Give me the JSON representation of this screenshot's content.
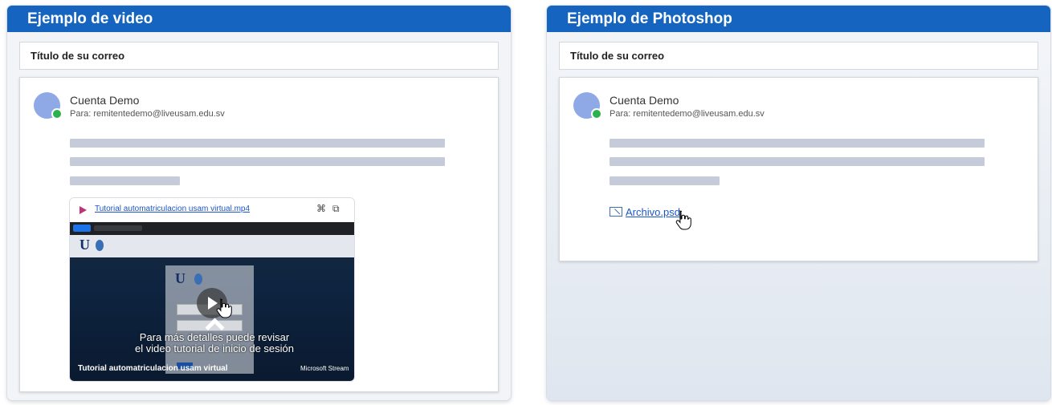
{
  "left": {
    "title": "Ejemplo de video",
    "subject": "Título de su correo",
    "sender_name": "Cuenta Demo",
    "sender_to": "Para:  remitentedemo@liveusam.edu.sv",
    "video": {
      "filename": "Tutorial automatriculacion usam virtual.mp4",
      "caption": "Para más detalles puede revisar el video tutorial de inicio de sesión",
      "title": "Tutorial automatriculacion usam virtual",
      "brand": "Microsoft Stream"
    }
  },
  "right": {
    "title": "Ejemplo de Photoshop",
    "subject": "Título de su correo",
    "sender_name": "Cuenta Demo",
    "sender_to": "Para:  remitentedemo@liveusam.edu.sv",
    "attachment": "Archivo.psd"
  },
  "colors": {
    "header": "#1565c0",
    "placeholder_bar": "#c6cbd9",
    "presence": "#2bb24c",
    "avatar": "#8fa8e6",
    "link": "#1a56c8"
  },
  "icons": [
    "presence-dot-icon",
    "stream-play-icon",
    "share-icon",
    "copy-icon",
    "play-icon",
    "chevron-up-icon",
    "hand-cursor-icon",
    "image-file-icon"
  ]
}
